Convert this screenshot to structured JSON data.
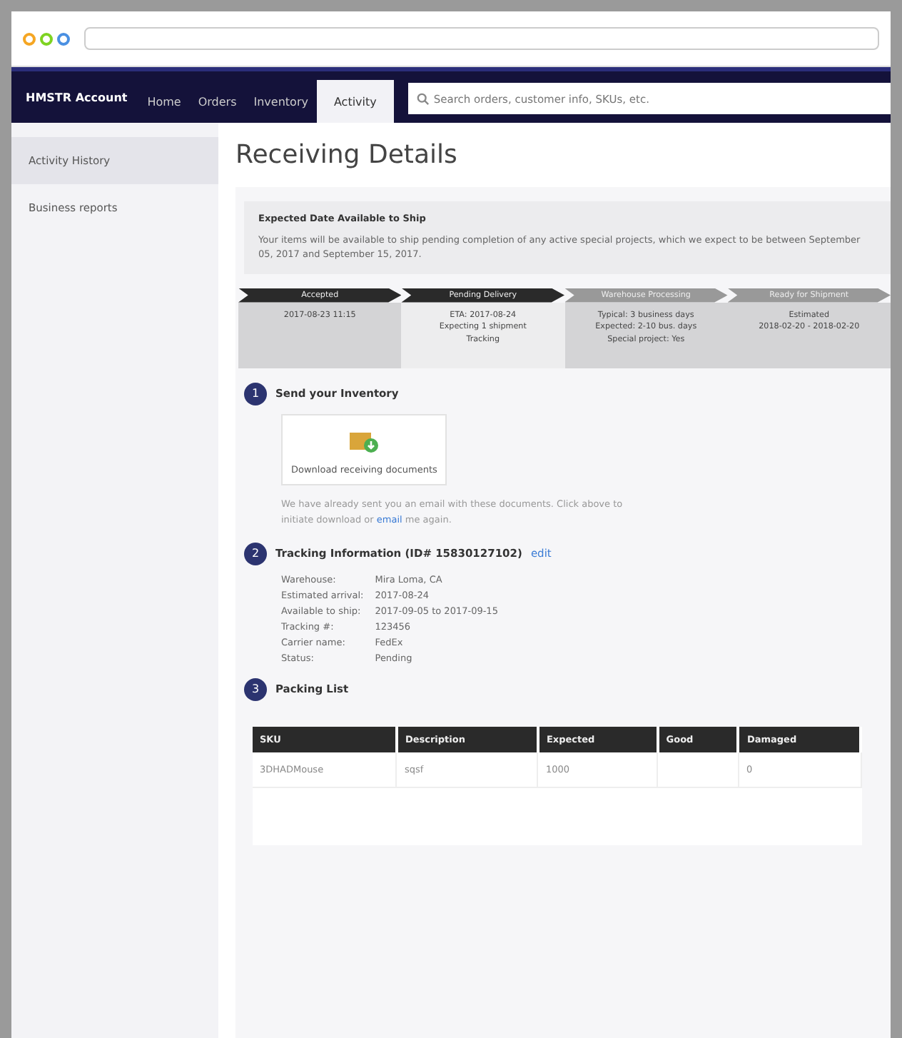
{
  "browser": {
    "dots": [
      {
        "color": "#f5a623"
      },
      {
        "color": "#7ed321"
      },
      {
        "color": "#4a90e2"
      }
    ]
  },
  "nav": {
    "brand": "HMSTR Account",
    "items": [
      {
        "label": "Home",
        "selected": false
      },
      {
        "label": "Orders",
        "selected": false
      },
      {
        "label": "Inventory",
        "selected": false
      },
      {
        "label": "Activity",
        "selected": true
      }
    ],
    "search": {
      "placeholder": "Search orders, customer info, SKUs, etc."
    }
  },
  "sidebar": {
    "items": [
      {
        "label": "Activity History",
        "selected": true
      },
      {
        "label": "Business reports",
        "selected": false
      }
    ]
  },
  "page_title": "Receiving Details",
  "notice": {
    "title": "Expected Date Available to Ship",
    "text": "Your items will be available to ship pending completion of any active special projects, which we expect to be between September 05, 2017 and September 15, 2017."
  },
  "steps": [
    {
      "label": "Accepted",
      "done": true,
      "current": false,
      "lines": [
        "2017-08-23 11:15"
      ]
    },
    {
      "label": "Pending Delivery",
      "done": true,
      "current": true,
      "lines": [
        "ETA: 2017-08-24",
        "Expecting 1 shipment",
        "Tracking"
      ]
    },
    {
      "label": "Warehouse Processing",
      "done": false,
      "current": false,
      "lines": [
        "Typical: 3 business days",
        "Expected: 2-10 bus. days",
        "Special project: Yes"
      ]
    },
    {
      "label": "Ready for Shipment",
      "done": false,
      "current": false,
      "lines": [
        "Estimated",
        "2018-02-20 - 2018-02-20"
      ]
    }
  ],
  "section1": {
    "number": "1",
    "title": "Send your Inventory",
    "button": "Download receiving documents",
    "note": "We have already sent you an email with these documents. Click above to initiate download or",
    "link": "email",
    "note_end": "me again."
  },
  "section2": {
    "number": "2",
    "title": "Tracking Information (ID# 15830127102)",
    "link": "edit",
    "fields": [
      {
        "label": "Warehouse:",
        "value": "Mira Loma, CA"
      },
      {
        "label": "Estimated arrival:",
        "value": "2017-08-24"
      },
      {
        "label": "Available to ship:",
        "value": "2017-09-05 to 2017-09-15"
      },
      {
        "label": "Tracking #:",
        "value": "123456"
      },
      {
        "label": "Carrier name:",
        "value": "FedEx"
      },
      {
        "label": "Status:",
        "value": "Pending"
      }
    ]
  },
  "section3": {
    "number": "3",
    "title": "Packing List",
    "table": {
      "columns": [
        "SKU",
        "Description",
        "Expected",
        "Good",
        "Damaged"
      ],
      "rows": [
        [
          "3DHADMouse",
          "sqsf",
          "1000",
          "",
          "0"
        ]
      ]
    }
  }
}
